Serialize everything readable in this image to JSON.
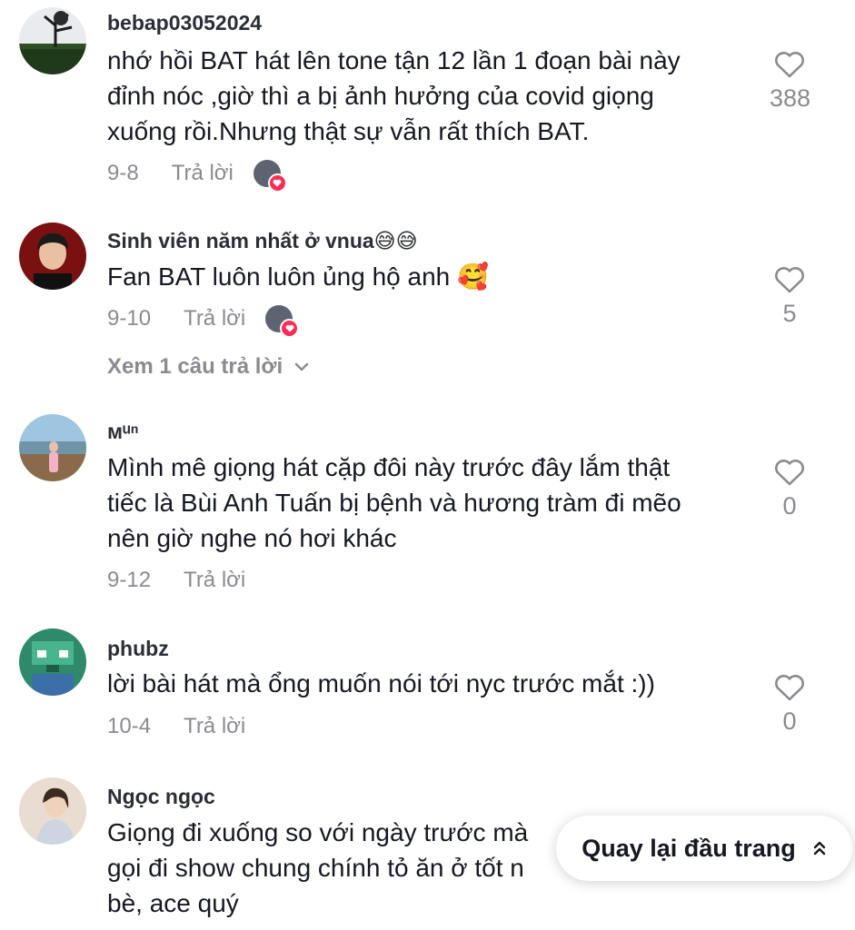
{
  "comments": [
    {
      "username": "bebap03052024",
      "text": "nhớ hồi BAT hát lên tone tận 12 lần 1 đoạn bài này\nđỉnh nóc ,giờ thì a bị ảnh hưởng của covid giọng\nxuống rồi.Nhưng thật sự vẫn rất thích BAT.",
      "date": "9-8",
      "reply_label": "Trả lời",
      "likes": "388"
    },
    {
      "username": "Sinh viên năm nhất ở vnua😅😅",
      "text": "Fan BAT luôn luôn ủng hộ anh 🥰",
      "date": "9-10",
      "reply_label": "Trả lời",
      "likes": "5",
      "view_replies": "Xem 1 câu trả lời"
    },
    {
      "username": "ᴍᵘⁿ",
      "text": "Mình mê giọng hát cặp đôi này trước đây lắm thật\ntiếc là Bùi Anh Tuấn bị bệnh và hương tràm đi mẽo\nnên giờ nghe nó hơi khác",
      "date": "9-12",
      "reply_label": "Trả lời",
      "likes": "0"
    },
    {
      "username": "phubz",
      "text": "lời bài hát mà ổng muốn nói tới nyc trước mắt :))",
      "date": "10-4",
      "reply_label": "Trả lời",
      "likes": "0"
    },
    {
      "username": "Ngọc ngọc",
      "text": "Giọng đi xuống so với ngày trước mà\ngọi đi show chung chính tỏ ăn ở tốt n\nbè, ace quý"
    }
  ],
  "back_to_top": "Quay lại đầu trang",
  "icons": {
    "like": "heart-outline-icon",
    "expand": "chevron-down-icon",
    "back_to_top": "double-chevron-up-icon",
    "creator_liked": "heart-badge-icon"
  },
  "colors": {
    "muted_text": "#8a8b91",
    "primary_text": "#161823",
    "accent": "#fe2c55"
  }
}
